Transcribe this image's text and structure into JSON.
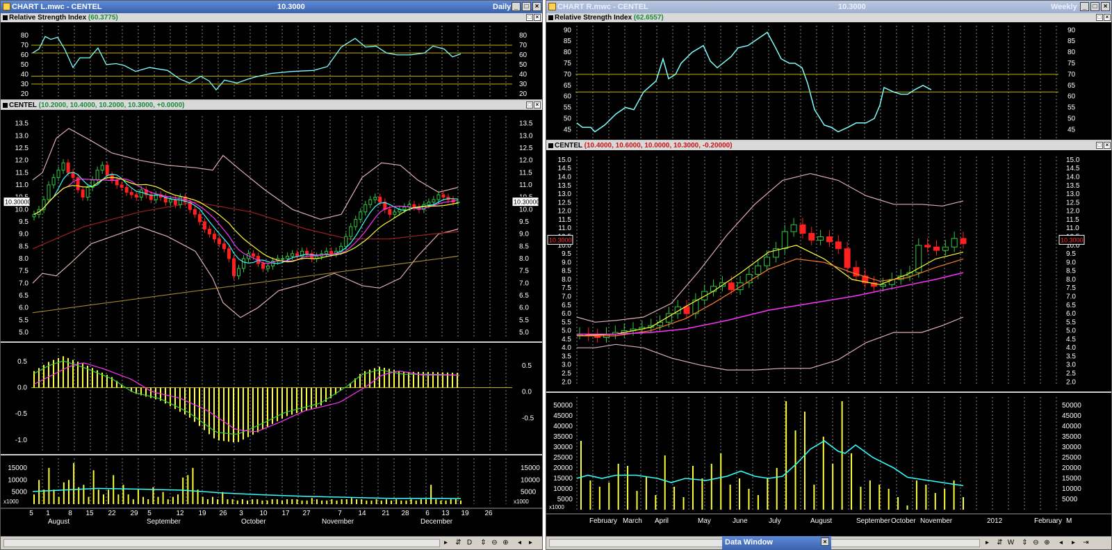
{
  "left": {
    "title": "CHART L.mwc - CENTEL",
    "title_value": "10.3000",
    "interval": "Daily",
    "rsi_header": "Relative Strength Index",
    "rsi_value": "(60.3775)",
    "price_header": "CENTEL",
    "price_values": "(10.2000, 10.4000, 10.2000, 10.3000, +0.0000)",
    "last_price": "10.30000",
    "rsi_ticks": [
      "80",
      "70",
      "60",
      "50",
      "40",
      "30",
      "20"
    ],
    "price_ticks": [
      "13.5",
      "13.0",
      "12.5",
      "12.0",
      "11.5",
      "11.0",
      "10.5",
      "10.0",
      "9.5",
      "9.0",
      "8.5",
      "8.0",
      "7.5",
      "7.0",
      "6.5",
      "6.0",
      "5.5",
      "5.0"
    ],
    "macd_ticks": [
      "0.5",
      "0.0",
      "-0.5",
      "-1.0"
    ],
    "macd_right_ticks": [
      "0.5",
      "0.0",
      "-0.5"
    ],
    "vol_ticks": [
      "15000",
      "10000",
      "5000"
    ],
    "vol_unit": "x1000",
    "day_ticks": [
      "5",
      "1",
      "8",
      "15",
      "22",
      "29",
      "5",
      "12",
      "19",
      "26",
      "3",
      "10",
      "17",
      "27",
      "7",
      "14",
      "21",
      "28",
      "6",
      "13",
      "19",
      "26"
    ],
    "month_ticks": [
      "August",
      "September",
      "October",
      "November",
      "December"
    ]
  },
  "right": {
    "title": "CHART R.mwc - CENTEL",
    "title_value": "10.3000",
    "interval": "Weekly",
    "rsi_header": "Relative Strength Index",
    "rsi_value": "(62.6557)",
    "price_header": "CENTEL",
    "price_values": "(10.4000, 10.6000, 10.0000, 10.3000, -0.20000)",
    "last_price": "10.3000",
    "rsi_ticks": [
      "90",
      "85",
      "80",
      "75",
      "70",
      "65",
      "60",
      "55",
      "50",
      "45"
    ],
    "price_ticks": [
      "15.0",
      "14.5",
      "14.0",
      "13.5",
      "13.0",
      "12.5",
      "12.0",
      "11.5",
      "11.0",
      "10.5",
      "10.0",
      "9.5",
      "9.0",
      "8.5",
      "8.0",
      "7.5",
      "7.0",
      "6.5",
      "6.0",
      "5.5",
      "5.0",
      "4.5",
      "4.0",
      "3.5",
      "3.0",
      "2.5",
      "2.0"
    ],
    "vol_ticks": [
      "50000",
      "45000",
      "40000",
      "35000",
      "30000",
      "25000",
      "20000",
      "15000",
      "10000",
      "5000"
    ],
    "vol_unit": "x1000",
    "month_ticks": [
      "February",
      "March",
      "April",
      "May",
      "June",
      "July",
      "August",
      "September",
      "October",
      "November",
      "2012",
      "February",
      "M"
    ]
  },
  "data_window": {
    "title": "Data Window",
    "close": "×"
  },
  "statusbar_icons": [
    "scroll-left",
    "scroll-right",
    "zoom-fit",
    "zoom-out",
    "zoom-in",
    "first",
    "prev",
    "next",
    "last"
  ],
  "colors": {
    "grid": "#8a8a8a",
    "rsi": "#80ffff",
    "band": "#e0b0b0",
    "up": "#2ecc40",
    "down": "#ff2020",
    "yellow": "#ffff33",
    "magenta": "#ff33ff",
    "cyan": "#33ffff",
    "orange": "#ff7f27"
  }
}
